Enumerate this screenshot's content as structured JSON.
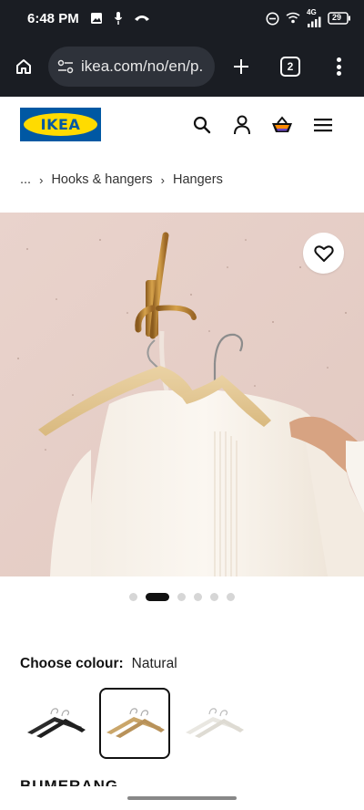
{
  "status_bar": {
    "time": "6:48 PM",
    "network": "4G",
    "battery": "29",
    "icons": [
      "gallery-icon",
      "mic-icon",
      "call-icon",
      "dnd-icon",
      "wifi-call-icon",
      "signal-icon",
      "battery-icon"
    ]
  },
  "browser": {
    "url": "ikea.com/no/en/p.",
    "tab_count": "2",
    "icons": [
      "home-icon",
      "site-settings-icon",
      "new-tab-icon",
      "tabs-icon",
      "more-icon"
    ]
  },
  "header": {
    "logo_text": "IKEA",
    "icons": [
      "search-icon",
      "account-icon",
      "cart-icon",
      "menu-icon"
    ]
  },
  "breadcrumb": {
    "items": [
      "...",
      "Hooks & hangers",
      "Hangers"
    ]
  },
  "hero": {
    "image": "hangers-on-wall-hook-photo",
    "favourite_icon": "heart-icon",
    "slide_count": 6,
    "active_slide": 2
  },
  "colour_chooser": {
    "label": "Choose colour:",
    "selected_value": "Natural",
    "swatches": [
      {
        "name": "black-hangers",
        "color": "#2b2b2b",
        "selected": false
      },
      {
        "name": "natural-hangers",
        "color": "#c9a66b",
        "selected": true
      },
      {
        "name": "white-hangers",
        "color": "#e6e4de",
        "selected": false
      }
    ]
  },
  "product": {
    "name": "BUMERANG"
  },
  "colors": {
    "system_bar": "#1a1d23",
    "ikea_blue": "#0058a3",
    "ikea_yellow": "#ffdb00",
    "wall": "#e7d1ca"
  }
}
